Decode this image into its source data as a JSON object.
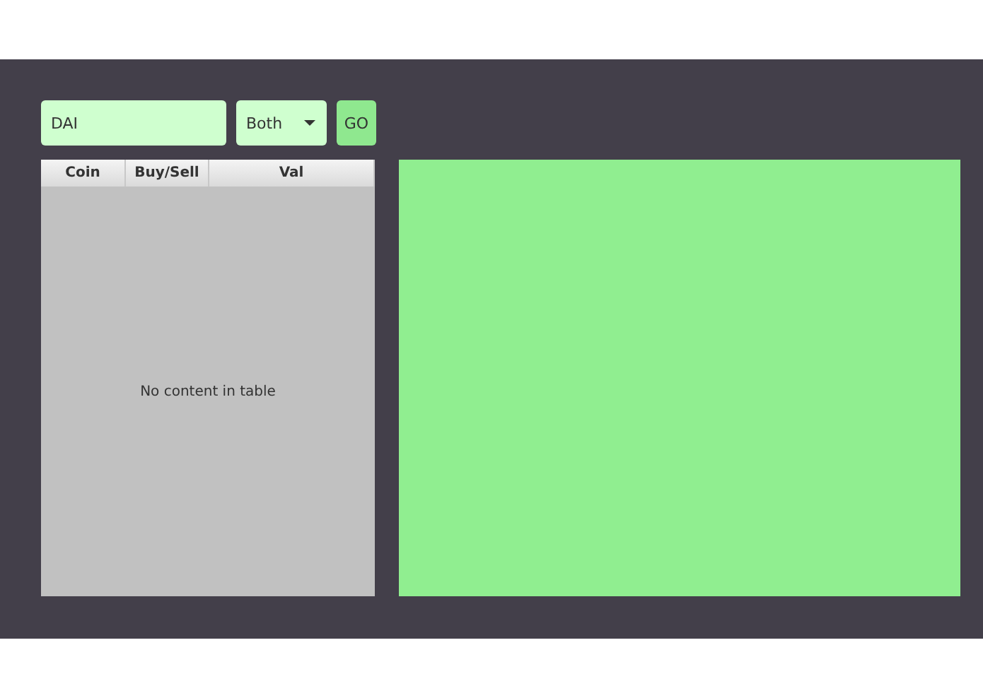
{
  "search": {
    "value": "DAI"
  },
  "filter": {
    "value": "Both"
  },
  "go_button": {
    "label": "GO"
  },
  "table": {
    "columns": [
      "Coin",
      "Buy/Sell",
      "Val"
    ],
    "empty_message": "No content in table"
  }
}
